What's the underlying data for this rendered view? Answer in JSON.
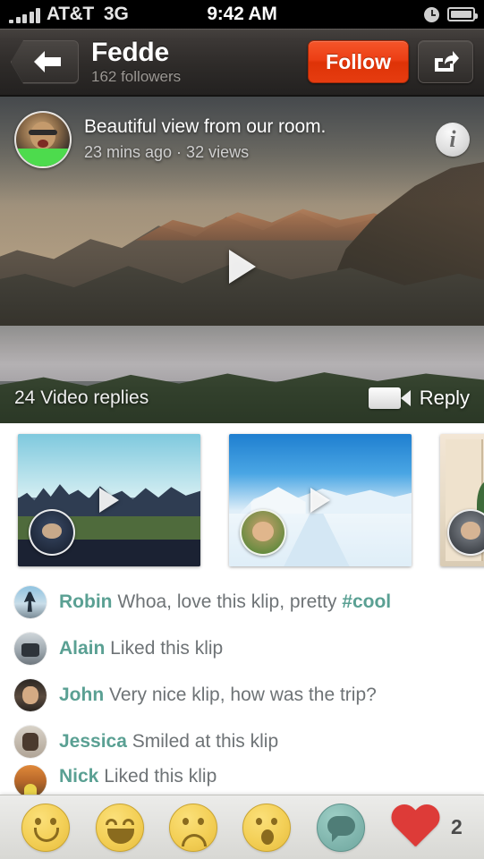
{
  "status_bar": {
    "carrier": "AT&T",
    "network": "3G",
    "time": "9:42 AM",
    "signal_icon": "signal-bars-icon",
    "clock_icon": "clock-icon",
    "battery_icon": "battery-icon"
  },
  "navbar": {
    "back_icon": "back-arrow-icon",
    "title": "Fedde",
    "subtitle": "162 followers",
    "follow_label": "Follow",
    "share_icon": "share-icon",
    "follow_color": "#e63c10"
  },
  "video": {
    "avatar_name": "poster-avatar",
    "caption": "Beautiful view from our room.",
    "meta": "23 mins ago · 32 views",
    "info_icon": "info-icon",
    "play_icon": "play-icon",
    "replies_label": "24 Video replies",
    "reply_label": "Reply",
    "camera_icon": "video-camera-icon"
  },
  "reply_thumbs": [
    {
      "name": "video-reply-city",
      "play_icon": "play-icon",
      "avatar": "reply-avatar-1"
    },
    {
      "name": "video-reply-snow",
      "play_icon": "play-icon",
      "avatar": "reply-avatar-2"
    },
    {
      "name": "video-reply-room",
      "play_icon": "play-icon",
      "avatar": "reply-avatar-3"
    }
  ],
  "comments": [
    {
      "user": "Robin",
      "text": " Whoa, love this klip, pretty ",
      "tag": "#cool"
    },
    {
      "user": "Alain",
      "text": " Liked this klip",
      "tag": ""
    },
    {
      "user": "John",
      "text": " Very nice klip, how was the trip?",
      "tag": ""
    },
    {
      "user": "Jessica",
      "text": " Smiled at this klip",
      "tag": ""
    },
    {
      "user": "Nick",
      "text": " Liked this klip",
      "tag": ""
    }
  ],
  "toolbar": {
    "reactions": [
      {
        "name": "smile-emoji-button",
        "label": "smile"
      },
      {
        "name": "grin-emoji-button",
        "label": "grin"
      },
      {
        "name": "sad-emoji-button",
        "label": "sad"
      },
      {
        "name": "surprised-emoji-button",
        "label": "surprised"
      }
    ],
    "comment_icon": "comment-bubble-icon",
    "heart_icon": "heart-icon",
    "heart_count": "2",
    "heart_color": "#dd3b38",
    "accent_teal": "#5aa093"
  }
}
